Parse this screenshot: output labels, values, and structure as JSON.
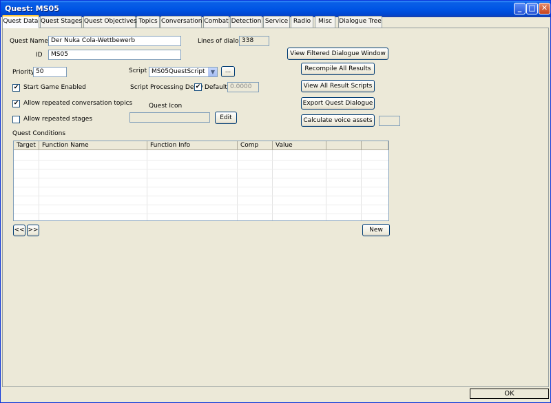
{
  "window": {
    "title": "Quest: MS05",
    "minimize_glyph": "_",
    "maximize_glyph": "□",
    "close_glyph": "✕"
  },
  "tabs": [
    {
      "label": "Quest Data"
    },
    {
      "label": "Quest Stages"
    },
    {
      "label": "Quest Objectives"
    },
    {
      "label": "Topics"
    },
    {
      "label": "Conversation"
    },
    {
      "label": "Combat"
    },
    {
      "label": "Detection"
    },
    {
      "label": "Service"
    },
    {
      "label": "Radio"
    },
    {
      "label": "Misc"
    },
    {
      "label": "Dialogue Tree"
    }
  ],
  "form": {
    "quest_name_label": "Quest Name",
    "quest_name_value": "Der Nuka Cola-Wettbewerb",
    "id_label": "ID",
    "id_value": "MS05",
    "lines_of_dialog_label": "Lines of dialog:",
    "lines_of_dialog_value": "338",
    "priority_label": "Priority",
    "priority_value": "50",
    "script_label": "Script",
    "script_value": "MS05QuestScript",
    "script_browse_label": "...",
    "start_game_enabled_label": "Start Game Enabled",
    "start_game_enabled_checked": true,
    "script_processing_delay_label": "Script Processing Delay",
    "default_label": "Default",
    "default_checked": true,
    "delay_value": "0.0000",
    "allow_repeated_topics_label": "Allow repeated conversation topics",
    "allow_repeated_topics_checked": true,
    "allow_repeated_stages_label": "Allow repeated stages",
    "allow_repeated_stages_checked": false,
    "quest_icon_label": "Quest Icon",
    "quest_icon_value": "",
    "edit_label": "Edit"
  },
  "actions": {
    "view_filtered_dialogue": "View Filtered Dialogue Window",
    "recompile_all": "Recompile All Results",
    "view_all_scripts": "View All Result Scripts",
    "export_dialogue": "Export Quest Dialogue",
    "calculate_voice": "Calculate voice assets",
    "calculate_voice_value": ""
  },
  "conditions": {
    "title": "Quest Conditions",
    "columns": [
      "Target",
      "Function Name",
      "Function Info",
      "Comp",
      "Value",
      "",
      ""
    ],
    "rows": [],
    "prev_label": "<<",
    "next_label": ">>",
    "new_label": "New"
  },
  "footer": {
    "ok_label": "OK"
  },
  "check_glyph": "✔"
}
